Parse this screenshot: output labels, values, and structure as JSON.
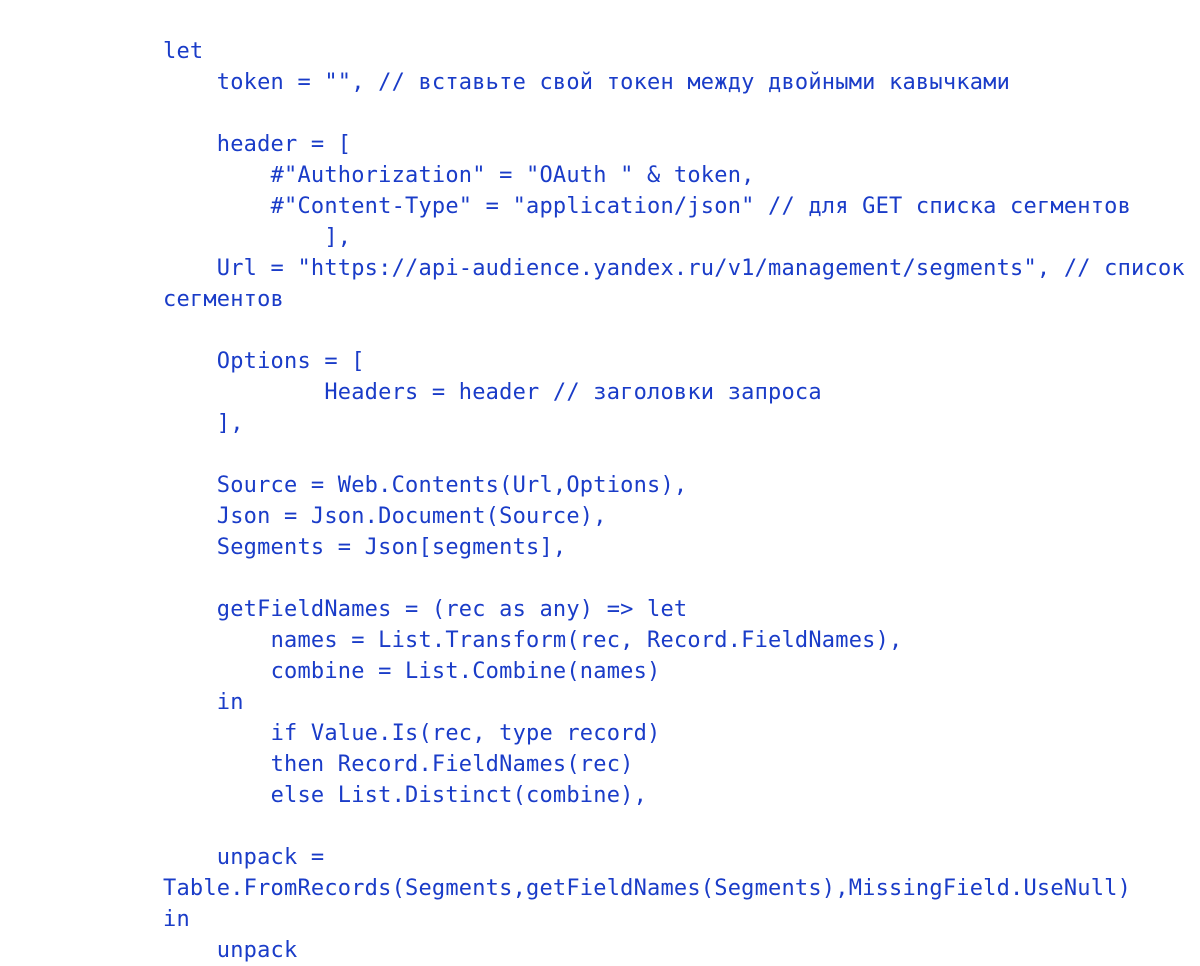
{
  "code": {
    "lines": [
      "let",
      "    token = \"\", // вставьте свой токен между двойными кавычками",
      "",
      "    header = [",
      "        #\"Authorization\" = \"OAuth \" & token,",
      "        #\"Content-Type\" = \"application/json\" // для GET списка сегментов",
      "            ],",
      "    Url = \"https://api-audience.yandex.ru/v1/management/segments\", // список",
      "сегментов",
      "",
      "    Options = [",
      "            Headers = header // заголовки запроса",
      "    ],",
      "",
      "    Source = Web.Contents(Url,Options),",
      "    Json = Json.Document(Source),",
      "    Segments = Json[segments],",
      "",
      "    getFieldNames = (rec as any) => let",
      "        names = List.Transform(rec, Record.FieldNames),",
      "        combine = List.Combine(names)",
      "    in",
      "        if Value.Is(rec, type record)",
      "        then Record.FieldNames(rec)",
      "        else List.Distinct(combine),",
      "",
      "    unpack =",
      "Table.FromRecords(Segments,getFieldNames(Segments),MissingField.UseNull)",
      "in",
      "    unpack"
    ]
  }
}
